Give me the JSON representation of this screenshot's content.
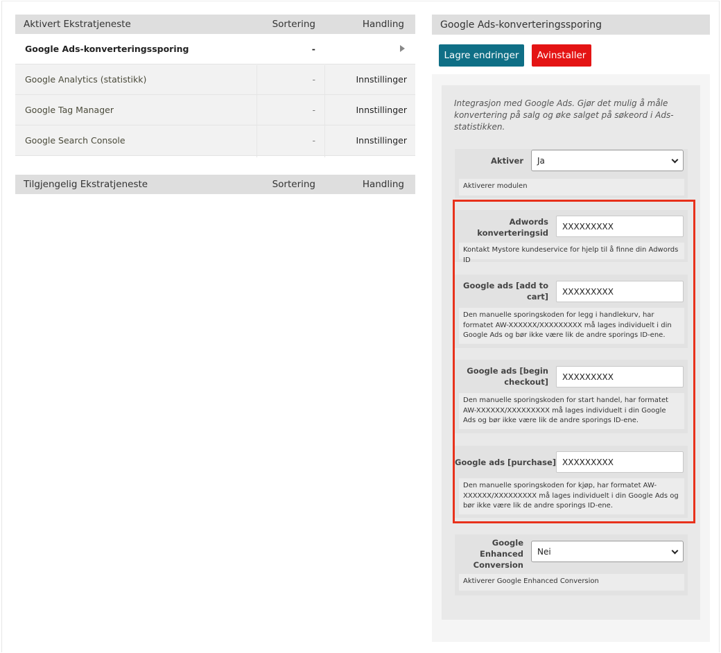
{
  "active_table": {
    "header": {
      "name": "Aktivert Ekstratjeneste",
      "sort": "Sortering",
      "action": "Handling"
    },
    "rows": [
      {
        "name": "Google Ads-konverteringssporing",
        "sort": "-",
        "action": ""
      },
      {
        "name": "Google Analytics (statistikk)",
        "sort": "-",
        "action": "Innstillinger"
      },
      {
        "name": "Google Tag Manager",
        "sort": "-",
        "action": "Innstillinger"
      },
      {
        "name": "Google Search Console",
        "sort": "-",
        "action": "Innstillinger"
      }
    ]
  },
  "available_table": {
    "header": {
      "name": "Tilgjengelig Ekstratjeneste",
      "sort": "Sortering",
      "action": "Handling"
    }
  },
  "panel": {
    "title": "Google Ads-konverteringssporing",
    "save_label": "Lagre endringer",
    "uninstall_label": "Avinstaller",
    "intro": "Integrasjon med Google Ads. Gjør det mulig å måle konvertering på salg og øke salget på søkeord i Ads-statistikken.",
    "fields": {
      "activate": {
        "label": "Aktiver",
        "value": "Ja",
        "help": "Aktiverer modulen"
      },
      "adwords_id": {
        "label_line1": "Adwords",
        "label_line2": "konverteringsid",
        "value": "XXXXXXXXX",
        "help": "Kontakt Mystore kundeservice for hjelp til å finne din Adwords ID"
      },
      "add_to_cart": {
        "label_line1": "Google ads [add to",
        "label_line2": "cart]",
        "value": "XXXXXXXXX",
        "help": "Den manuelle sporingskoden for legg i handlekurv, har formatet AW-XXXXXX/XXXXXXXXX må lages individuelt i din Google Ads og bør ikke være lik de andre sporings ID-ene."
      },
      "begin_checkout": {
        "label_line1": "Google ads [begin",
        "label_line2": "checkout]",
        "value": "XXXXXXXXX",
        "help": "Den manuelle sporingskoden for start handel, har formatet AW-XXXXXX/XXXXXXXXX må lages individuelt i din Google Ads og bør ikke være lik de andre sporings ID-ene."
      },
      "purchase": {
        "label": "Google ads [purchase]",
        "value": "XXXXXXXXX",
        "help": "Den manuelle sporingskoden for kjøp, har formatet AW-XXXXXX/XXXXXXXXX må lages individuelt i din Google Ads og bør ikke være lik de andre sporings ID-ene."
      },
      "enhanced": {
        "label_line1": "Google",
        "label_line2": "Enhanced",
        "label_line3": "Conversion",
        "value": "Nei",
        "help": "Aktiverer Google Enhanced Conversion"
      }
    }
  },
  "colors": {
    "save_button": "#0f6f86",
    "uninstall_button": "#e41414",
    "highlight": "#e8321c"
  },
  "icons": {
    "row_expand": "play-triangle-icon",
    "select_arrow": "chevron-down-icon"
  }
}
